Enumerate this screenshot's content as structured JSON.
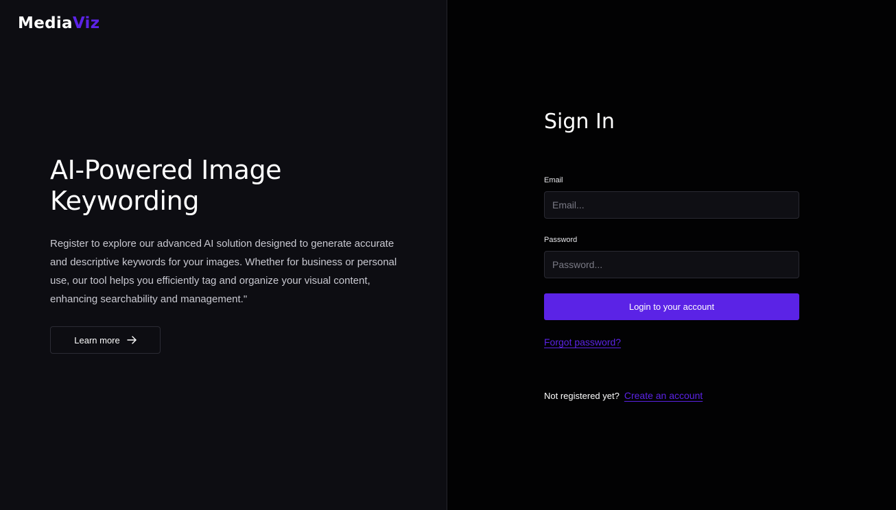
{
  "brand": {
    "name_part1": "Media",
    "name_part2": "Viz",
    "accent_color": "#5b23e6"
  },
  "hero": {
    "title": "AI-Powered Image Keywording",
    "description": "Register to explore our advanced AI solution designed to generate accurate and descriptive keywords for your images. Whether for business or personal use, our tool helps you efficiently tag and organize your visual content, enhancing searchability and management.\"",
    "learn_more_label": "Learn more",
    "learn_more_icon": "arrow-right-icon"
  },
  "signin": {
    "title": "Sign In",
    "email_label": "Email",
    "email_placeholder": "Email...",
    "email_value": "",
    "password_label": "Password",
    "password_placeholder": "Password...",
    "password_value": "",
    "login_label": "Login to your account",
    "forgot_label": "Forgot password?",
    "not_registered_text": "Not registered yet?",
    "create_account_label": "Create an account"
  }
}
